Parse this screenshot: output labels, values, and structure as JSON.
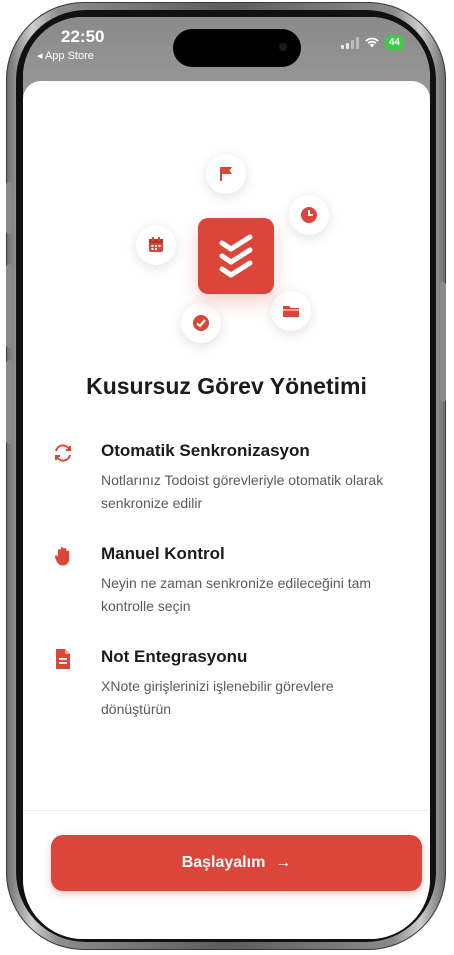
{
  "status_bar": {
    "time": "22:50",
    "back_app": "◂ App Store",
    "battery": "44"
  },
  "onboarding": {
    "title": "Kusursuz Görev Yönetimi",
    "features": [
      {
        "icon": "sync-icon",
        "title": "Otomatik Senkronizasyon",
        "description": "Notlarınız Todoist görevleriyle otomatik olarak senkronize edilir"
      },
      {
        "icon": "hand-stop-icon",
        "title": "Manuel Kontrol",
        "description": "Neyin ne zaman senkronize edileceğini tam kontrolle seçin"
      },
      {
        "icon": "document-icon",
        "title": "Not Entegrasyonu",
        "description": "XNote girişlerinizi işlenebilir görevlere dönüştürün"
      }
    ],
    "cta_label": "Başlayalım",
    "cta_arrow": "→"
  },
  "colors": {
    "accent": "#dc4539",
    "text_primary": "#1b1b1b",
    "text_secondary": "#5b5b5b"
  }
}
